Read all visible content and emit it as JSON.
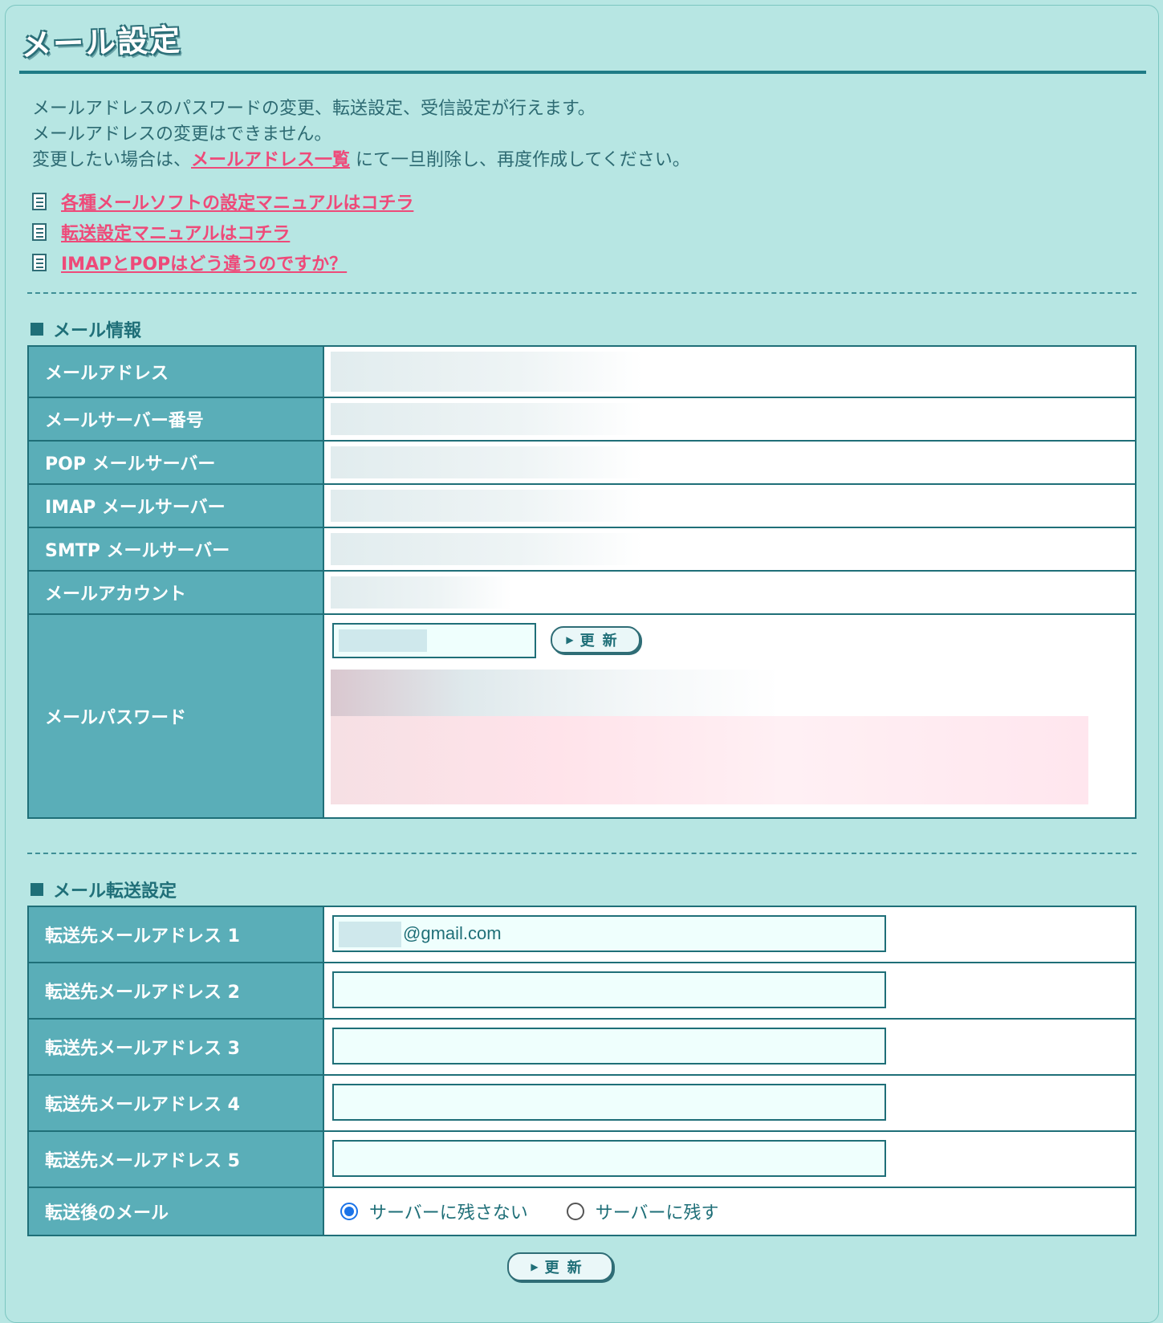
{
  "page": {
    "title": "メール設定",
    "intro_line1": "メールアドレスのパスワードの変更、転送設定、受信設定が行えます。",
    "intro_line2": "メールアドレスの変更はできません。",
    "intro_line3_pre": "変更したい場合は、",
    "intro_link": "メールアドレス一覧",
    "intro_line3_post": " にて一旦削除し、再度作成してください。"
  },
  "manual_links": [
    "各種メールソフトの設定マニュアルはコチラ",
    "転送設定マニュアルはコチラ",
    "IMAPとPOPはどう違うのですか？"
  ],
  "mail_info": {
    "heading": "メール情報",
    "rows": [
      "メールアドレス",
      "メールサーバー番号",
      "POP メールサーバー",
      "IMAP メールサーバー",
      "SMTP メールサーバー",
      "メールアカウント",
      "メールパスワード"
    ],
    "update_button": "更新"
  },
  "forward": {
    "heading": "メール転送設定",
    "rows": [
      "転送先メールアドレス 1",
      "転送先メールアドレス 2",
      "転送先メールアドレス 3",
      "転送先メールアドレス 4",
      "転送先メールアドレス 5"
    ],
    "address1_value": "@gmail.com",
    "after_label": "転送後のメール",
    "option_no_keep": "サーバーに残さない",
    "option_keep": "サーバーに残す",
    "selected_option": "サーバーに残さない"
  },
  "submit_button": "更新",
  "colors": {
    "background": "#b7e6e3",
    "label_cell": "#5aaeb8",
    "accent_link": "#ee4a79",
    "border": "#1f6f78"
  }
}
